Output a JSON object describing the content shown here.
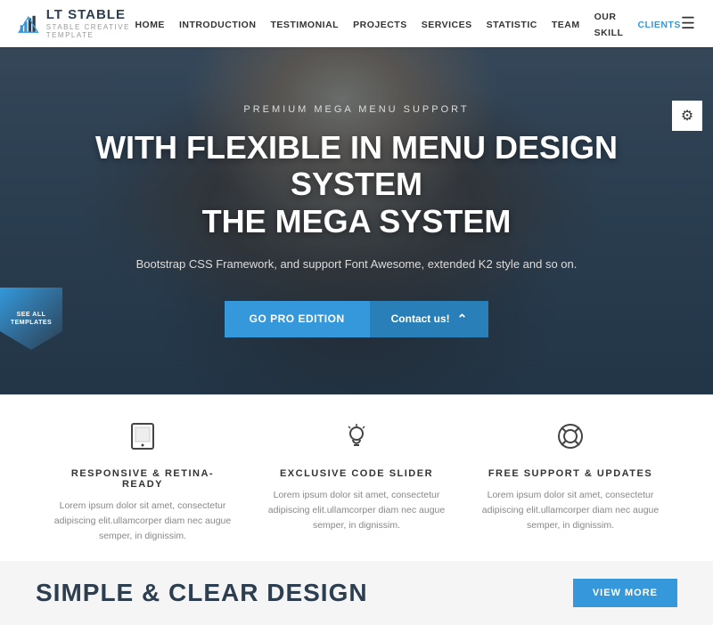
{
  "navbar": {
    "logo_title": "LT STABLE",
    "logo_subtitle": "STABLE CREATIVE TEMPLATE",
    "nav_items": [
      {
        "label": "HOME",
        "id": "home"
      },
      {
        "label": "INTRODUCTION",
        "id": "introduction"
      },
      {
        "label": "TESTIMONIAL",
        "id": "testimonial"
      },
      {
        "label": "PROJECTS",
        "id": "projects"
      },
      {
        "label": "SERVICES",
        "id": "services"
      },
      {
        "label": "STATISTIC",
        "id": "statistic"
      },
      {
        "label": "TEAM",
        "id": "team"
      },
      {
        "label": "OUR SKILL",
        "id": "our-skill"
      },
      {
        "label": "CLIENTS",
        "id": "clients"
      }
    ]
  },
  "hero": {
    "sub_title": "PREMIUM MEGA MENU SUPPORT",
    "title_line1": "WITH FLEXIBLE IN MENU DESIGN SYSTEM",
    "title_line2": "THE MEGA SYSTEM",
    "description": "Bootstrap CSS Framework, and support Font Awesome, extended K2 style and so on.",
    "btn_primary": "Go Pro Edition",
    "btn_secondary": "Contact us!",
    "badge_line1": "SEE ALL",
    "badge_line2": "TEMPLATES"
  },
  "features": [
    {
      "icon": "tablet",
      "title": "RESPONSIVE & RETINA-READY",
      "desc": "Lorem ipsum dolor sit amet, consectetur adipiscing elit.ullamcorper diam nec augue semper, in dignissim."
    },
    {
      "icon": "bulb",
      "title": "EXCLUSIVE CODE SLIDER",
      "desc": "Lorem ipsum dolor sit amet, consectetur adipiscing elit.ullamcorper diam nec augue semper, in dignissim."
    },
    {
      "icon": "lifering",
      "title": "FREE SUPPORT & UPDATES",
      "desc": "Lorem ipsum dolor sit amet, consectetur adipiscing elit.ullamcorper diam nec augue semper, in dignissim."
    }
  ],
  "bottom": {
    "heading": "SIMPLE & CLEAR DESIGN",
    "view_more": "VIEW MORE"
  },
  "gear_icon": "⚙",
  "hamburger_icon": "☰"
}
